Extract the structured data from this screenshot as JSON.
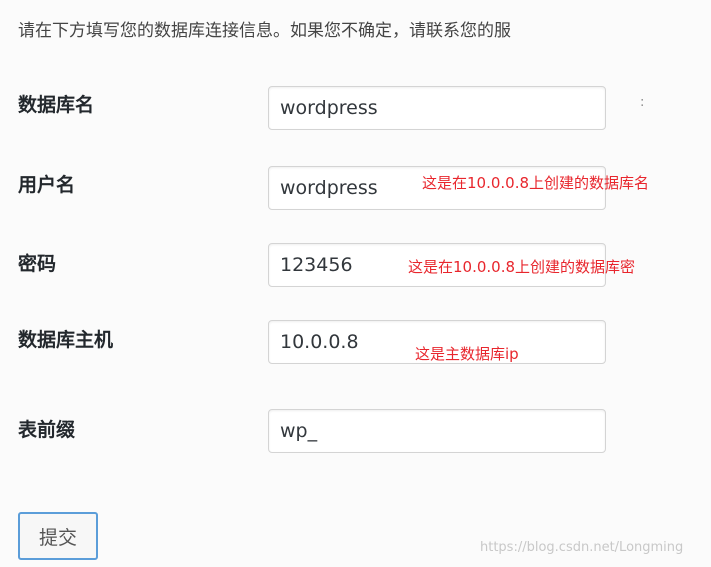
{
  "intro": {
    "text": "请在下方填写您的数据库连接信息。如果您不确定，请联系您的服"
  },
  "form": {
    "rows": [
      {
        "label": "数据库名",
        "value": "wordpress",
        "note": "",
        "side": ":"
      },
      {
        "label": "用户名",
        "value": "wordpress",
        "note": "这是在10.0.0.8上创建的数据库名",
        "side": ""
      },
      {
        "label": "密码",
        "value": "123456",
        "note": "这是在10.0.0.8上创建的数据库密",
        "side": ""
      },
      {
        "label": "数据库主机",
        "value": "10.0.0.8",
        "note": "这是主数据库ip",
        "side": ""
      },
      {
        "label": "表前缀",
        "value": "wp_",
        "note": "",
        "side": ""
      }
    ]
  },
  "submit": {
    "label": "提交"
  },
  "watermark": {
    "text": "https://blog.csdn.net/Longming"
  }
}
